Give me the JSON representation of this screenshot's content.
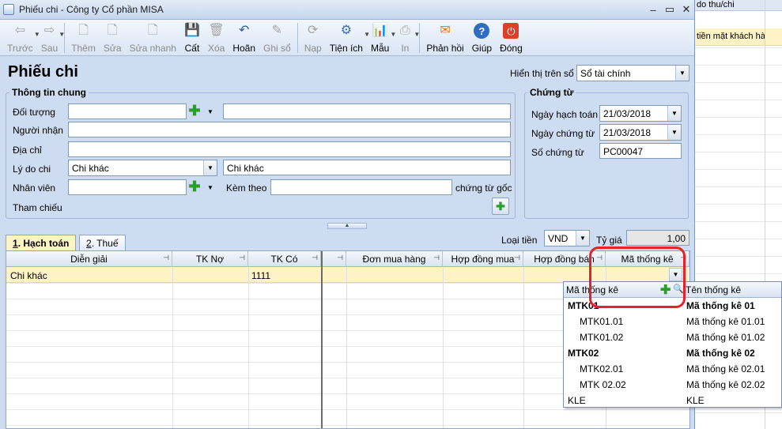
{
  "window": {
    "title": "Phiếu chi - Công ty Cổ phần MISA"
  },
  "toolbar": {
    "items": [
      {
        "label": "Trước",
        "icon": "arrow-left-icon",
        "glyph": "⇦",
        "enabled": false,
        "dropdown": true
      },
      {
        "label": "Sau",
        "icon": "arrow-right-icon",
        "glyph": "⇨",
        "enabled": false,
        "dropdown": true
      },
      {
        "label": "Thêm",
        "icon": "add-doc-icon",
        "glyph": "🗋",
        "enabled": false
      },
      {
        "label": "Sửa",
        "icon": "edit-doc-icon",
        "glyph": "🗋",
        "enabled": false
      },
      {
        "label": "Sửa nhanh",
        "icon": "quick-edit-icon",
        "glyph": "🗋",
        "enabled": false
      },
      {
        "label": "Cất",
        "icon": "save-icon",
        "glyph": "💾",
        "enabled": true
      },
      {
        "label": "Xóa",
        "icon": "delete-icon",
        "glyph": "🗑",
        "enabled": false
      },
      {
        "label": "Hoãn",
        "icon": "undo-icon",
        "glyph": "↶",
        "enabled": true
      },
      {
        "label": "Ghi sổ",
        "icon": "pencil-icon",
        "glyph": "✎",
        "enabled": false
      },
      {
        "label": "Nạp",
        "icon": "reload-icon",
        "glyph": "⟳",
        "enabled": false
      },
      {
        "label": "Tiện ích",
        "icon": "utilities-icon",
        "glyph": "⚙",
        "enabled": true,
        "dropdown": true
      },
      {
        "label": "Mẫu",
        "icon": "template-icon",
        "glyph": "📊",
        "enabled": true,
        "dropdown": true
      },
      {
        "label": "In",
        "icon": "print-icon",
        "glyph": "⎙",
        "enabled": false,
        "dropdown": true
      },
      {
        "label": "Phản hồi",
        "icon": "feedback-mail-icon",
        "glyph": "✉",
        "enabled": true
      },
      {
        "label": "Giúp",
        "icon": "help-icon",
        "glyph": "?",
        "enabled": true
      },
      {
        "label": "Đóng",
        "icon": "close-power-icon",
        "glyph": "⏻",
        "enabled": true
      }
    ]
  },
  "form": {
    "title": "Phiếu chi",
    "display_label": "Hiển thị trên sổ",
    "display_value": "Sổ tài chính"
  },
  "general": {
    "group_title": "Thông tin chung",
    "doi_tuong_label": "Đối tượng",
    "doi_tuong_value": "",
    "doi_tuong_name": "",
    "nguoi_nhan_label": "Người nhận",
    "nguoi_nhan_value": "",
    "dia_chi_label": "Địa chỉ",
    "dia_chi_value": "",
    "ly_do_label": "Lý do chi",
    "ly_do_value": "Chi khác",
    "ly_do_text": "Chi khác",
    "nhan_vien_label": "Nhân viên",
    "nhan_vien_value": "",
    "kem_theo_label": "Kèm theo",
    "kem_theo_value": "",
    "chung_tu_goc_label": "chứng từ gốc",
    "tham_chieu_label": "Tham chiếu"
  },
  "voucher": {
    "group_title": "Chứng từ",
    "ngay_hach_toan_label": "Ngày hạch toán",
    "ngay_hach_toan_value": "21/03/2018",
    "ngay_chung_tu_label": "Ngày chứng từ",
    "ngay_chung_tu_value": "21/03/2018",
    "so_chung_tu_label": "Số chứng từ",
    "so_chung_tu_value": "PC00047"
  },
  "tabs": [
    {
      "key": "1",
      "rest": ". Hạch toán"
    },
    {
      "key": "2",
      "rest": ". Thuế"
    }
  ],
  "currency": {
    "loai_tien_label": "Loại tiền",
    "loai_tien_value": "VND",
    "ty_gia_label": "Tỷ giá",
    "ty_gia_value": "1,00"
  },
  "grid": {
    "columns": [
      "Diễn giải",
      "TK Nợ",
      "TK Có",
      "",
      "Đơn mua hàng",
      "Hợp đồng mua",
      "Hợp đồng bán",
      "Mã thống kê"
    ],
    "row": {
      "dien_giai": "Chi khác",
      "tk_no": "",
      "tk_co": "1111"
    }
  },
  "popup": {
    "col1_header": "Mã thống kê",
    "col2_header": "Tên thống kê",
    "rows": [
      {
        "code": "MTK01",
        "name": "Mã thống kê 01",
        "bold": true
      },
      {
        "code": "MTK01.01",
        "name": "Mã thống kê 01.01",
        "bold": false
      },
      {
        "code": "MTK01.02",
        "name": "Mã thống kê 01.02",
        "bold": false
      },
      {
        "code": "MTK02",
        "name": "Mã thống kê 02",
        "bold": true
      },
      {
        "code": "MTK02.01",
        "name": "Mã thống kê 02.01",
        "bold": false
      },
      {
        "code": "MTK 02.02",
        "name": "Mã thống kê 02.02",
        "bold": false
      },
      {
        "code": "KLE",
        "name": "KLE",
        "bold": false
      }
    ]
  },
  "background_window": {
    "header_text": "do thu/chi",
    "row_text": "tiền mặt khách hà"
  },
  "colors": {
    "accent_highlight": "#e8202a",
    "selected_row": "#fdf3c6",
    "form_bg": "#cddcf0"
  }
}
